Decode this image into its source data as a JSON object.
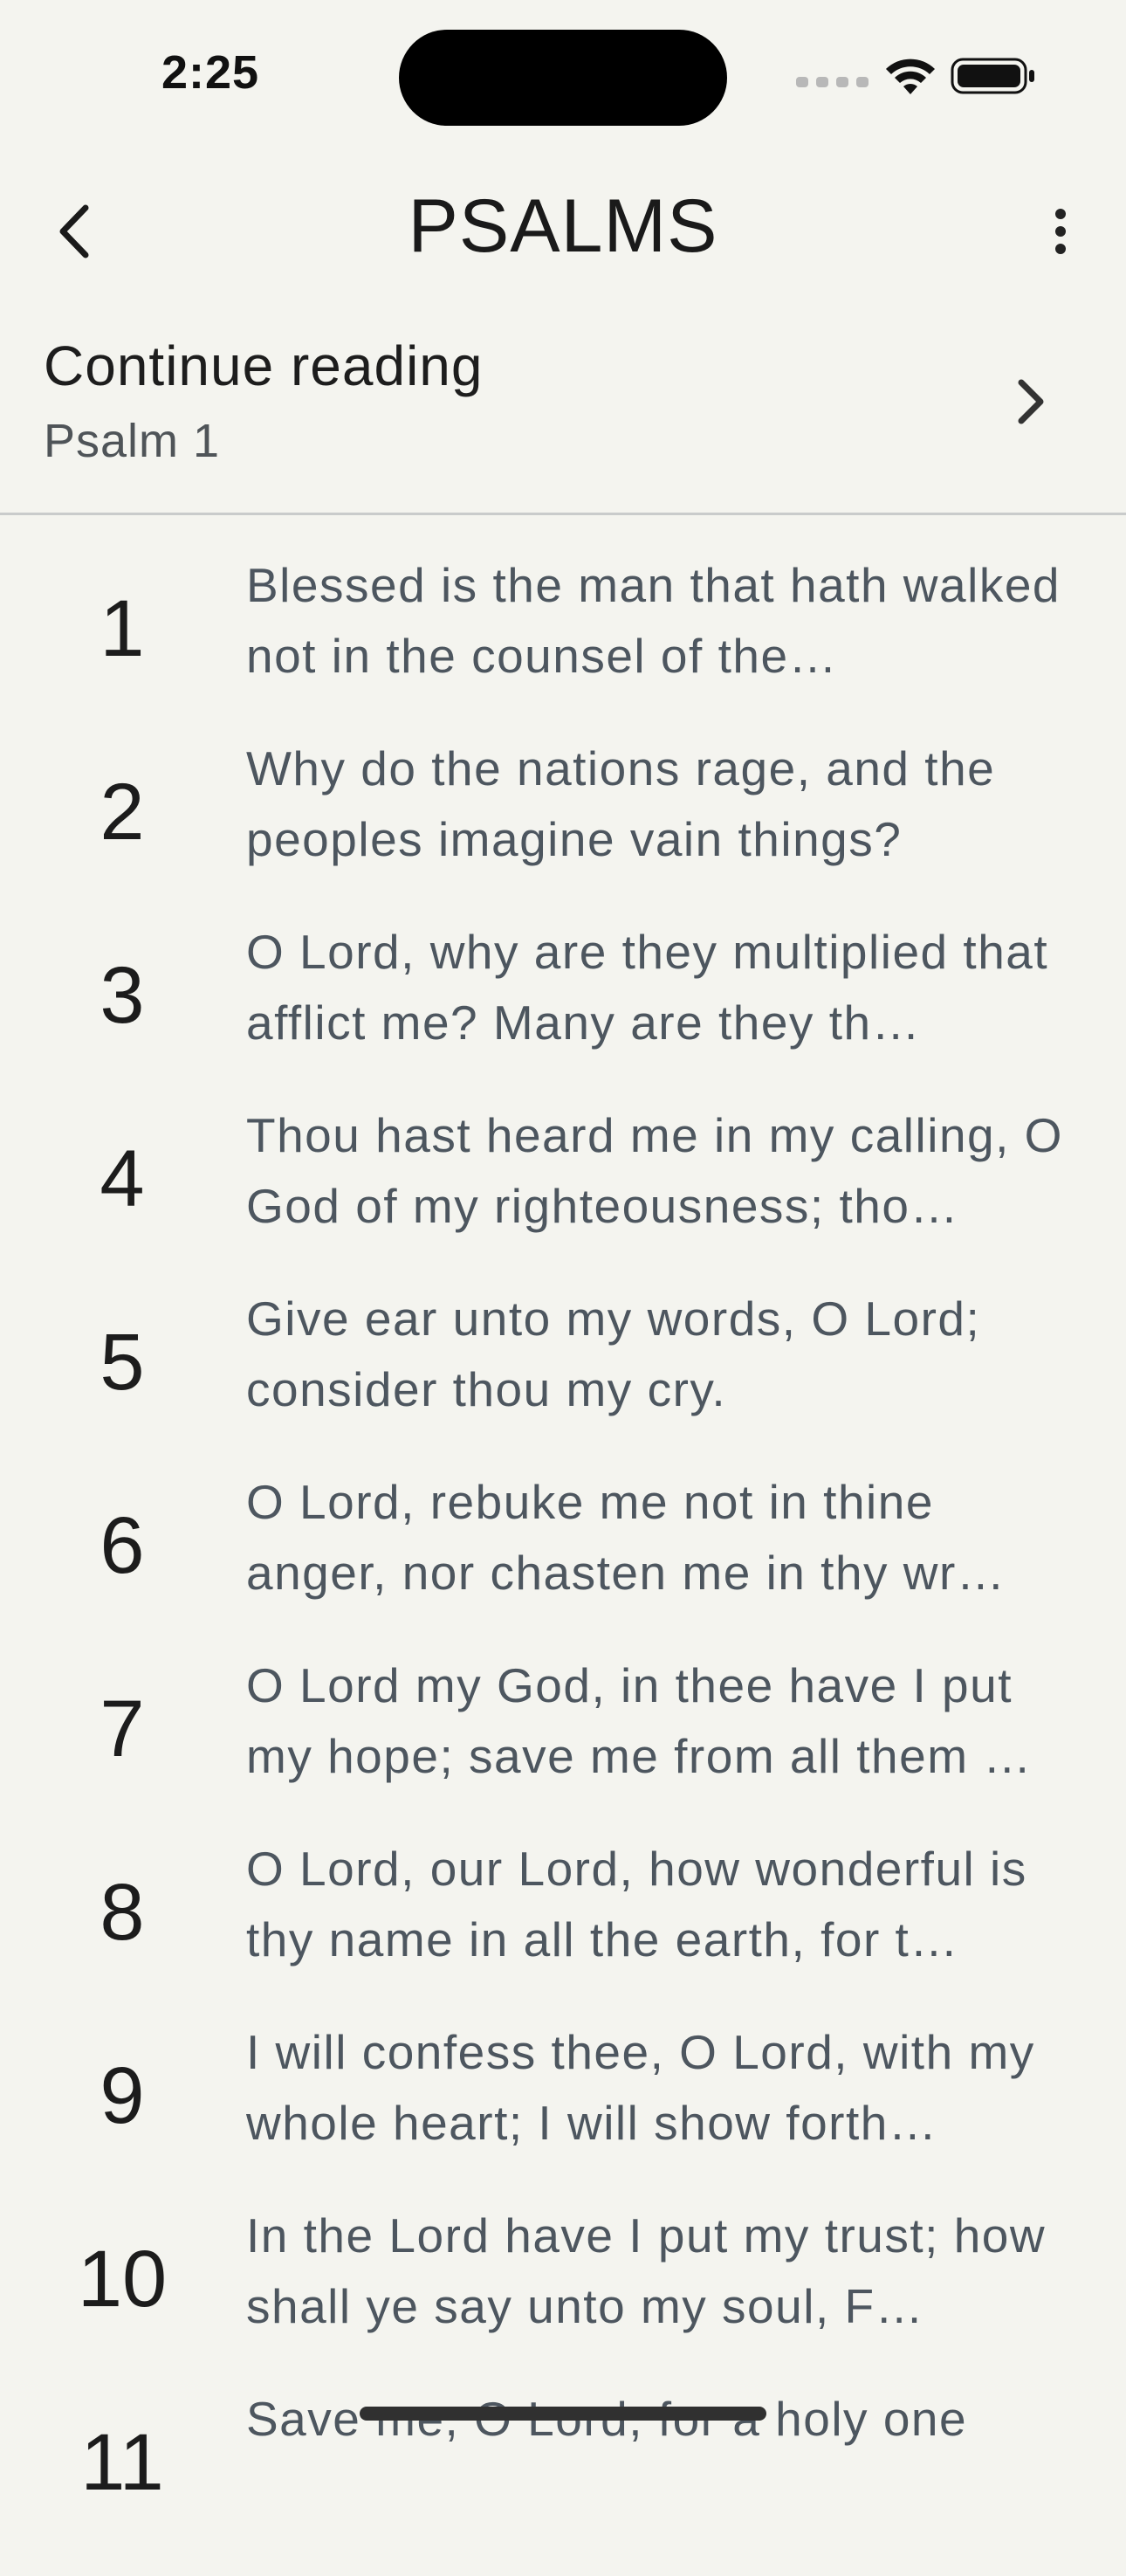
{
  "status_bar": {
    "time": "2:25"
  },
  "nav": {
    "title": "PSALMS",
    "back_icon": "chevron-left-icon",
    "more_icon": "more-vertical-icon"
  },
  "continue_reading": {
    "title": "Continue reading",
    "subtitle": "Psalm 1",
    "icon": "chevron-right-icon"
  },
  "chapters": [
    {
      "number": "1",
      "preview": "Blessed is the man that hath walked not in the counsel of the…"
    },
    {
      "number": "2",
      "preview": "Why do the nations rage, and the peoples imagine vain things?"
    },
    {
      "number": "3",
      "preview": "O Lord, why are they multiplied that afflict me? Many are they th…"
    },
    {
      "number": "4",
      "preview": "Thou hast heard me in my calling, O God of my righteousness; tho…"
    },
    {
      "number": "5",
      "preview": "Give ear unto my words, O Lord; consider thou my cry."
    },
    {
      "number": "6",
      "preview": "O Lord, rebuke me not in thine anger, nor chasten me in thy wr…"
    },
    {
      "number": "7",
      "preview": "O Lord my God, in thee have I put my hope; save me from all them …"
    },
    {
      "number": "8",
      "preview": "O Lord, our Lord, how wonderful is thy name in all the earth, for t…"
    },
    {
      "number": "9",
      "preview": "I will confess thee, O Lord, with my whole heart; I will show forth…"
    },
    {
      "number": "10",
      "preview": "In the Lord have I put my trust; how shall ye say unto my soul, F…"
    },
    {
      "number": "11",
      "preview": "Save me, O Lord, for a holy one"
    }
  ]
}
